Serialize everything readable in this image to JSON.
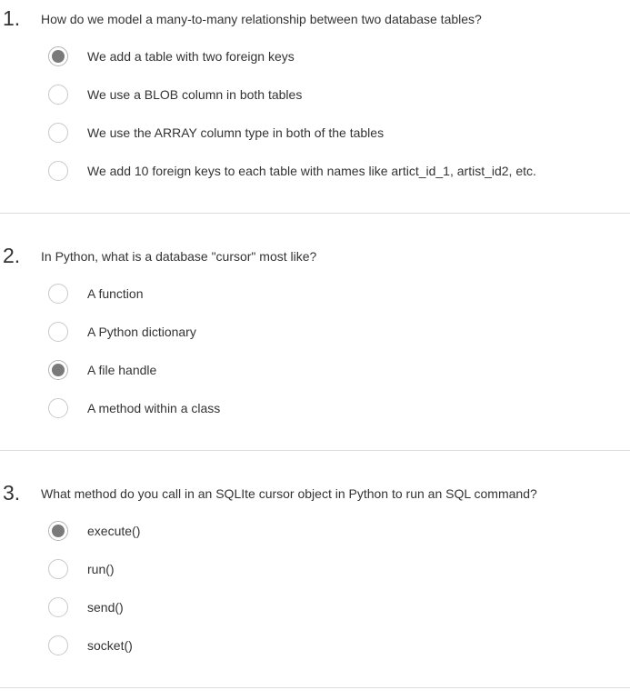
{
  "questions": [
    {
      "number": "1.",
      "text": "How do we model a many-to-many relationship between two database tables?",
      "selected_index": 0,
      "options": [
        {
          "label": "We add a table with two foreign keys"
        },
        {
          "label": "We use a BLOB column in both tables"
        },
        {
          "label": "We use the ARRAY column type in both of the tables"
        },
        {
          "label": "We add 10 foreign keys to each table with names like artict_id_1, artist_id2, etc."
        }
      ]
    },
    {
      "number": "2.",
      "text": "In Python, what is a database \"cursor\" most like?",
      "selected_index": 2,
      "options": [
        {
          "label": "A function"
        },
        {
          "label": "A Python dictionary"
        },
        {
          "label": "A file handle"
        },
        {
          "label": "A method within a class"
        }
      ]
    },
    {
      "number": "3.",
      "text": "What method do you call in an SQLIte cursor object in Python to run an SQL command?",
      "selected_index": 0,
      "options": [
        {
          "label": "execute()"
        },
        {
          "label": "run()"
        },
        {
          "label": "send()"
        },
        {
          "label": "socket()"
        }
      ]
    }
  ],
  "colors": {
    "radio_fill_selected": "#7a7a7a",
    "radio_border": "#c9c9c9",
    "divider": "#dcdcdc",
    "text": "#333333"
  }
}
